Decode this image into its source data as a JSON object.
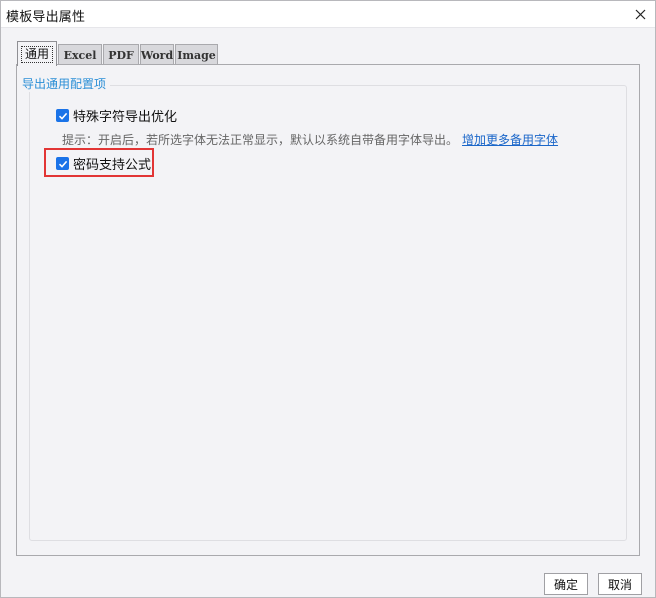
{
  "window": {
    "title": "模板导出属性",
    "close_icon": "close-icon"
  },
  "tabs": [
    {
      "label": "通用",
      "active": true
    },
    {
      "label": "Excel",
      "active": false
    },
    {
      "label": "PDF",
      "active": false
    },
    {
      "label": "Word",
      "active": false
    },
    {
      "label": "Image",
      "active": false
    }
  ],
  "general": {
    "group_title": "导出通用配置项",
    "special_char_optimize": {
      "label": "特殊字符导出优化",
      "checked": true
    },
    "hint": {
      "text": "提示：开启后，若所选字体无法正常显示，默认以系统自带备用字体导出。",
      "link": "增加更多备用字体"
    },
    "password_formula": {
      "label": "密码支持公式",
      "checked": true
    }
  },
  "footer": {
    "ok_label": "确定",
    "cancel_label": "取消"
  },
  "colors": {
    "accent": "#1a73e8",
    "group_title": "#2b8fd6",
    "link": "#1a66c9",
    "highlight": "#e23535"
  }
}
